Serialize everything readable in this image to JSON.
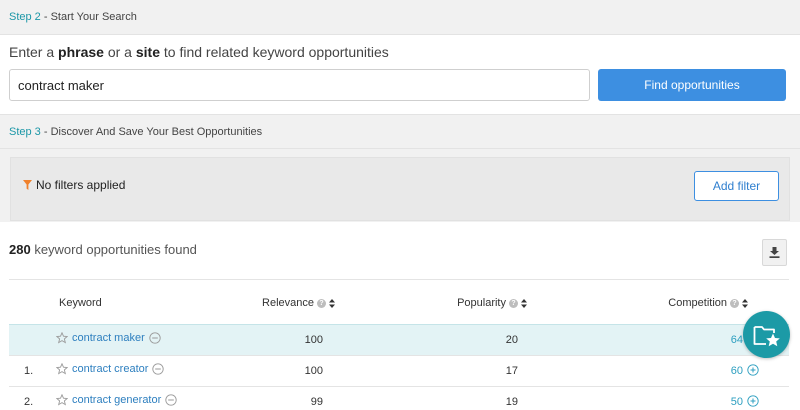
{
  "step2": {
    "number": "Step 2",
    "separator": " - ",
    "title": "Start Your Search"
  },
  "search": {
    "prompt_prefix": "Enter a ",
    "prompt_phrase": "phrase",
    "prompt_or": " or a ",
    "prompt_site": "site",
    "prompt_suffix": " to find related keyword opportunities",
    "input_value": "contract maker",
    "button_label": "Find opportunities"
  },
  "step3": {
    "number": "Step 3",
    "separator": " - ",
    "title": "Discover And Save Your Best Opportunities"
  },
  "filters": {
    "label": "No filters applied",
    "add_button_label": "Add filter"
  },
  "results": {
    "count": "280",
    "count_label": " keyword opportunities found"
  },
  "table": {
    "columns": {
      "keyword": "Keyword",
      "relevance": "Relevance",
      "popularity": "Popularity",
      "competition": "Competition"
    },
    "rows": [
      {
        "index": "",
        "keyword": "contract maker",
        "relevance": "100",
        "popularity": "20",
        "competition": "64"
      },
      {
        "index": "1.",
        "keyword": "contract creator",
        "relevance": "100",
        "popularity": "17",
        "competition": "60"
      },
      {
        "index": "2.",
        "keyword": "contract generator",
        "relevance": "99",
        "popularity": "19",
        "competition": "50"
      }
    ]
  },
  "icons": {
    "filter": "filter-funnel-icon",
    "download": "download-icon",
    "help": "help-circle-icon",
    "sort": "sort-icon",
    "star": "star-outline-icon",
    "minus": "minus-circle-icon",
    "competition": "plus-circle-icon",
    "fab": "folder-star-icon"
  },
  "colors": {
    "accent": "#1c97a7",
    "primary_button": "#3d8fe1",
    "highlight_row": "#e3f3f5",
    "filter_icon": "#f0812b",
    "link": "#2d7fbf"
  }
}
